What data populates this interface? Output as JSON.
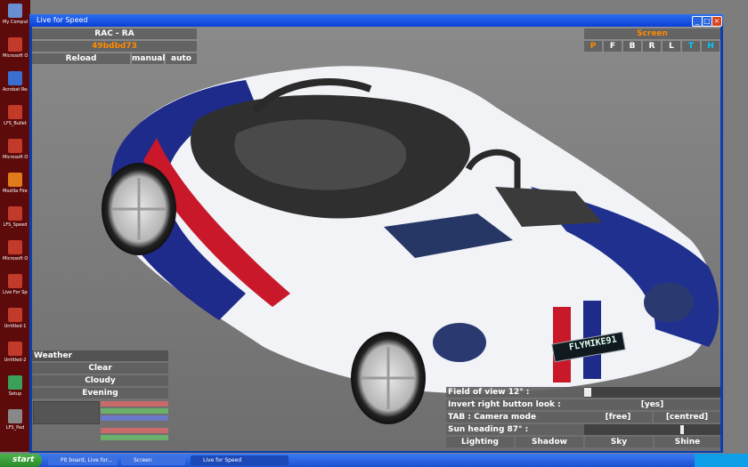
{
  "desktop": {
    "icons": [
      {
        "label": "My Computer",
        "color": "#6a8fd0"
      },
      {
        "label": "Microsoft Office Wo...",
        "color": "#c23a2a"
      },
      {
        "label": "Acrobat Reader",
        "color": "#3a6fd0"
      },
      {
        "label": "LFS_Bullet",
        "color": "#c23a2a"
      },
      {
        "label": "Microsoft Office Wo...",
        "color": "#c23a2a"
      },
      {
        "label": "Mozilla Firefox",
        "color": "#e07a1a"
      },
      {
        "label": "LFS_Speed",
        "color": "#c23a2a"
      },
      {
        "label": "Microsoft Office Po...",
        "color": "#c23a2a"
      },
      {
        "label": "Live For Speed",
        "color": "#c23a2a"
      },
      {
        "label": "Untitled-1",
        "color": "#c23a2a"
      },
      {
        "label": "Untitled-2",
        "color": "#c23a2a"
      },
      {
        "label": "Setup",
        "color": "#3aa05a"
      },
      {
        "label": "LFS_Pad",
        "color": "#888888"
      }
    ]
  },
  "window": {
    "title": "Live for Speed",
    "min": "_",
    "max": "□",
    "close": "×"
  },
  "top_left": {
    "car_name": "RAC - RA",
    "skin_name": "49bdbd73",
    "reload": "Reload",
    "manual": "manual",
    "auto": "auto"
  },
  "top_right": {
    "screen": "Screen",
    "buttons": [
      "P",
      "F",
      "B",
      "R",
      "L",
      "T",
      "H"
    ]
  },
  "weather": {
    "title": "Weather",
    "options": [
      "Clear",
      "Cloudy",
      "Evening"
    ]
  },
  "settings": {
    "fov_label": "Field of view 12° :",
    "invert_label": "Invert right button look :",
    "invert_value": "[yes]",
    "tab_label": "TAB : Camera mode",
    "tab_free": "[free]",
    "tab_centred": "[centred]",
    "sun_label": "Sun heading 87° :",
    "tabs": [
      "Lighting",
      "Shadow",
      "Sky",
      "Shine"
    ]
  },
  "plate": "FLYMIKE91",
  "taskbar": {
    "start": "start",
    "tasks": [
      "Pit board, Live for...",
      "Screen",
      "Live for Speed"
    ]
  }
}
